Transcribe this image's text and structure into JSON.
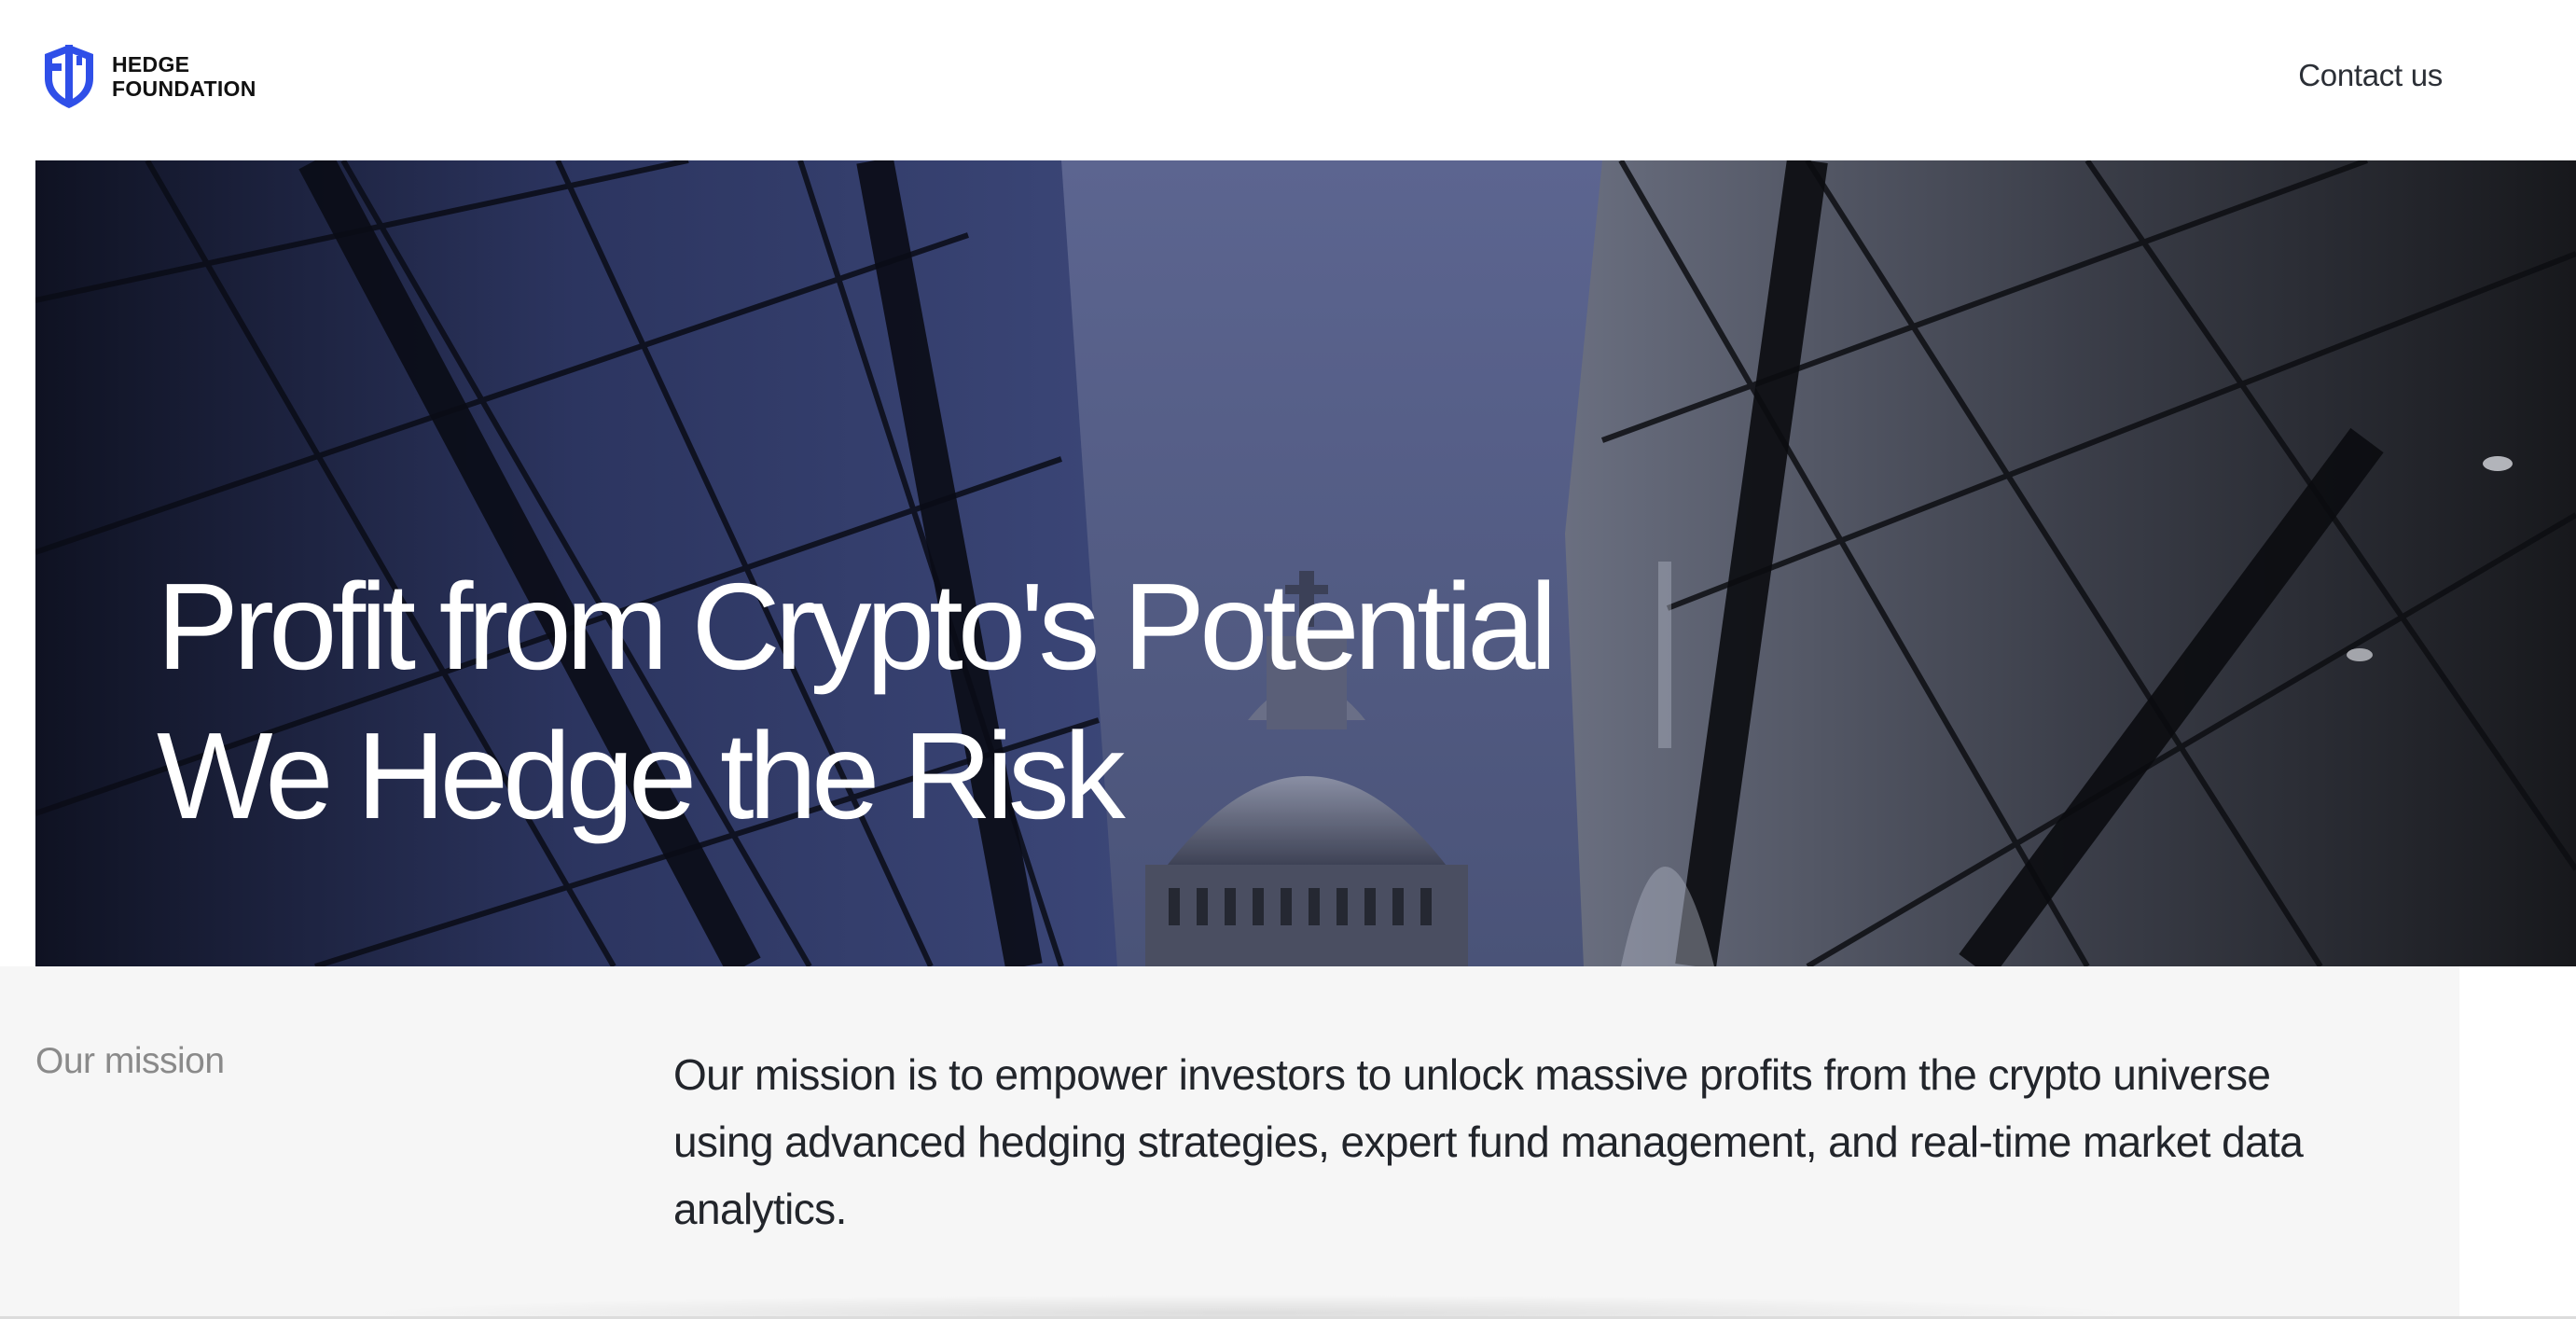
{
  "header": {
    "logo": {
      "line1": "HEDGE",
      "line2": "FOUNDATION",
      "color": "#2f4fe8"
    },
    "contact_label": "Contact us"
  },
  "hero": {
    "title_line1": "Profit from Crypto's Potential",
    "title_line2": "We Hedge the Risk"
  },
  "mission": {
    "label": "Our mission",
    "text": "Our mission is to empower investors to unlock massive profits from the crypto universe using advanced hedging strategies, expert fund management, and real-time market data analytics."
  }
}
